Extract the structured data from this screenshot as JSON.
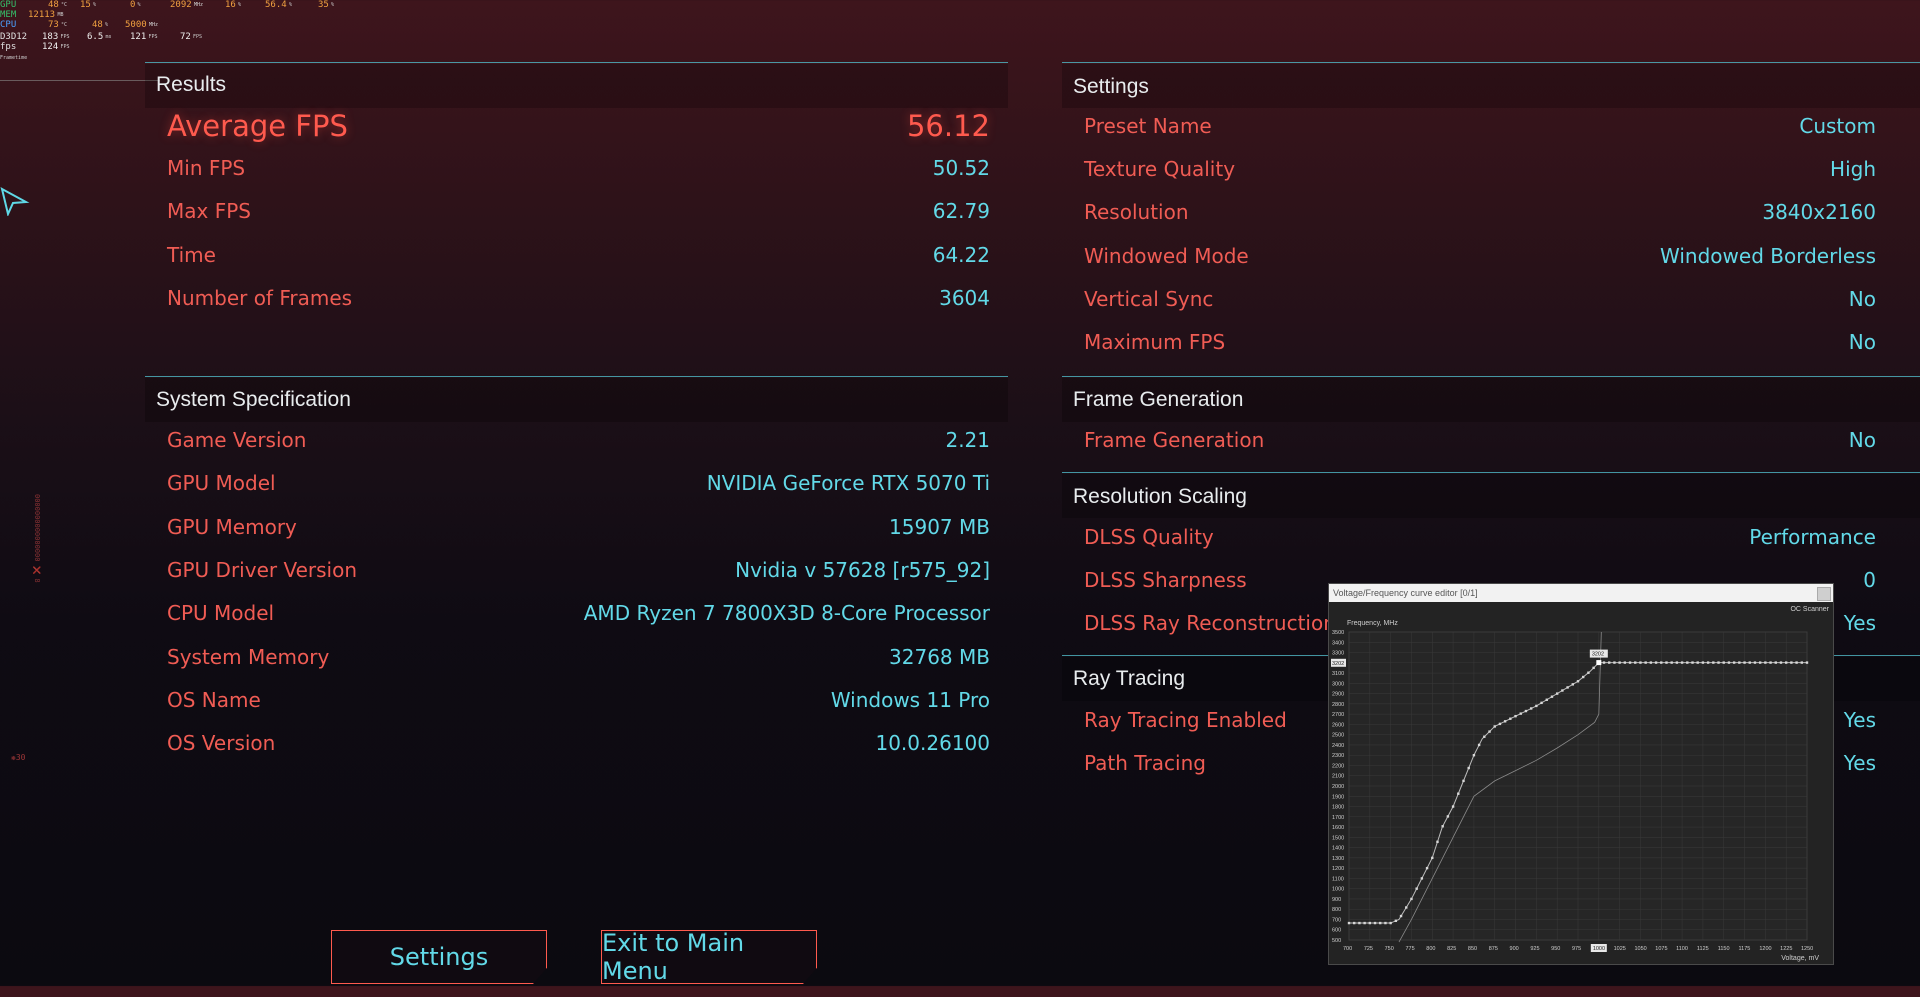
{
  "osd": {
    "rows": [
      {
        "label": "GPU",
        "label_color": "green",
        "values": [
          "48",
          "15",
          "0",
          "2092",
          "16",
          "56.4",
          "35"
        ],
        "units": [
          "°C",
          "%",
          "%",
          "MHz",
          "%",
          "%",
          "%"
        ]
      },
      {
        "label": "MEM",
        "label_color": "green",
        "values": [
          "12113"
        ],
        "units": [
          "MB"
        ]
      },
      {
        "label": "CPU",
        "label_color": "blue",
        "values": [
          "73",
          "48",
          "5000"
        ],
        "units": [
          "°C",
          "%",
          "MHz"
        ]
      },
      {
        "label": "D3D12",
        "label_color": "white",
        "values": [
          "183",
          "6.5",
          "121",
          "72"
        ],
        "units": [
          "FPS",
          "ms",
          "FPS",
          "FPS"
        ]
      },
      {
        "label": "fps",
        "label_color": "white",
        "values": [
          "124"
        ],
        "units": [
          "FPS"
        ]
      }
    ],
    "sub_label": "Frametime"
  },
  "results": {
    "title": "Results",
    "average_fps": {
      "label": "Average FPS",
      "value": "56.12"
    },
    "rows": [
      {
        "label": "Min FPS",
        "value": "50.52"
      },
      {
        "label": "Max FPS",
        "value": "62.79"
      },
      {
        "label": "Time",
        "value": "64.22"
      },
      {
        "label": "Number of Frames",
        "value": "3604"
      }
    ]
  },
  "system": {
    "title": "System Specification",
    "rows": [
      {
        "label": "Game Version",
        "value": "2.21"
      },
      {
        "label": "GPU Model",
        "value": "NVIDIA GeForce RTX 5070 Ti"
      },
      {
        "label": "GPU Memory",
        "value": "15907 MB"
      },
      {
        "label": "GPU Driver Version",
        "value": "Nvidia v 57628 [r575_92]"
      },
      {
        "label": "CPU Model",
        "value": "AMD Ryzen 7 7800X3D 8-Core Processor"
      },
      {
        "label": "System Memory",
        "value": "32768 MB"
      },
      {
        "label": "OS Name",
        "value": "Windows 11 Pro"
      },
      {
        "label": "OS Version",
        "value": "10.0.26100"
      }
    ]
  },
  "settings": {
    "title": "Settings",
    "rows": [
      {
        "label": "Preset Name",
        "value": "Custom"
      },
      {
        "label": "Texture Quality",
        "value": "High"
      },
      {
        "label": "Resolution",
        "value": "3840x2160"
      },
      {
        "label": "Windowed Mode",
        "value": "Windowed Borderless"
      },
      {
        "label": "Vertical Sync",
        "value": "No"
      },
      {
        "label": "Maximum FPS",
        "value": "No"
      }
    ]
  },
  "frame_generation": {
    "title": "Frame Generation",
    "rows": [
      {
        "label": "Frame Generation",
        "value": "No"
      }
    ]
  },
  "resolution_scaling": {
    "title": "Resolution Scaling",
    "rows": [
      {
        "label": "DLSS Quality",
        "value": "Performance"
      },
      {
        "label": "DLSS Sharpness",
        "value": "0"
      },
      {
        "label": "DLSS Ray Reconstruction E",
        "value": "Yes"
      }
    ]
  },
  "ray_tracing": {
    "title": "Ray Tracing",
    "rows": [
      {
        "label": "Ray Tracing Enabled",
        "value": "Yes"
      },
      {
        "label": "Path Tracing",
        "value": "Yes"
      }
    ]
  },
  "buttons": {
    "settings": "Settings",
    "exit": "Exit to Main Menu"
  },
  "side_glyphs": "0000000000000000 ❌ 8",
  "side_glyph2": "❋30",
  "vf_editor": {
    "title": "Voltage/Frequency curve editor [0/1]",
    "scanner": "OC Scanner",
    "y_axis_label": "Frequency, MHz",
    "x_axis_label": "Voltage, mV",
    "y_ticks": [
      "500",
      "600",
      "700",
      "800",
      "900",
      "1000",
      "1100",
      "1200",
      "1300",
      "1400",
      "1500",
      "1600",
      "1700",
      "1800",
      "1900",
      "2000",
      "2100",
      "2200",
      "2300",
      "2400",
      "2500",
      "2600",
      "2700",
      "2800",
      "2900",
      "3000",
      "3100",
      "3200",
      "3300",
      "3400",
      "3500"
    ],
    "x_ticks": [
      "700",
      "725",
      "750",
      "775",
      "800",
      "825",
      "850",
      "875",
      "900",
      "925",
      "950",
      "975",
      "1000",
      "1025",
      "1050",
      "1075",
      "1100",
      "1125",
      "1150",
      "1175",
      "1200",
      "1225",
      "1250"
    ],
    "x_highlight": "1000",
    "y_highlight": "3202",
    "point_label": "3202",
    "curve": [
      [
        700,
        665
      ],
      [
        725,
        665
      ],
      [
        750,
        665
      ],
      [
        760,
        700
      ],
      [
        775,
        900
      ],
      [
        800,
        1300
      ],
      [
        812,
        1600
      ],
      [
        825,
        1800
      ],
      [
        835,
        2000
      ],
      [
        850,
        2300
      ],
      [
        860,
        2460
      ],
      [
        875,
        2580
      ],
      [
        900,
        2680
      ],
      [
        925,
        2780
      ],
      [
        950,
        2900
      ],
      [
        975,
        3020
      ],
      [
        990,
        3120
      ],
      [
        1000,
        3202
      ],
      [
        1250,
        3202
      ]
    ],
    "base_curve": [
      [
        760,
        480
      ],
      [
        775,
        700
      ],
      [
        800,
        1100
      ],
      [
        825,
        1500
      ],
      [
        850,
        1900
      ],
      [
        875,
        2050
      ],
      [
        900,
        2150
      ],
      [
        925,
        2250
      ],
      [
        950,
        2370
      ],
      [
        975,
        2500
      ],
      [
        995,
        2620
      ],
      [
        1000,
        2700
      ],
      [
        1003,
        3500
      ]
    ],
    "colors": {
      "bg": "#232323",
      "grid": "#3a3a3a",
      "curve": "#bdbdbd",
      "base": "#8a8a8a"
    }
  }
}
